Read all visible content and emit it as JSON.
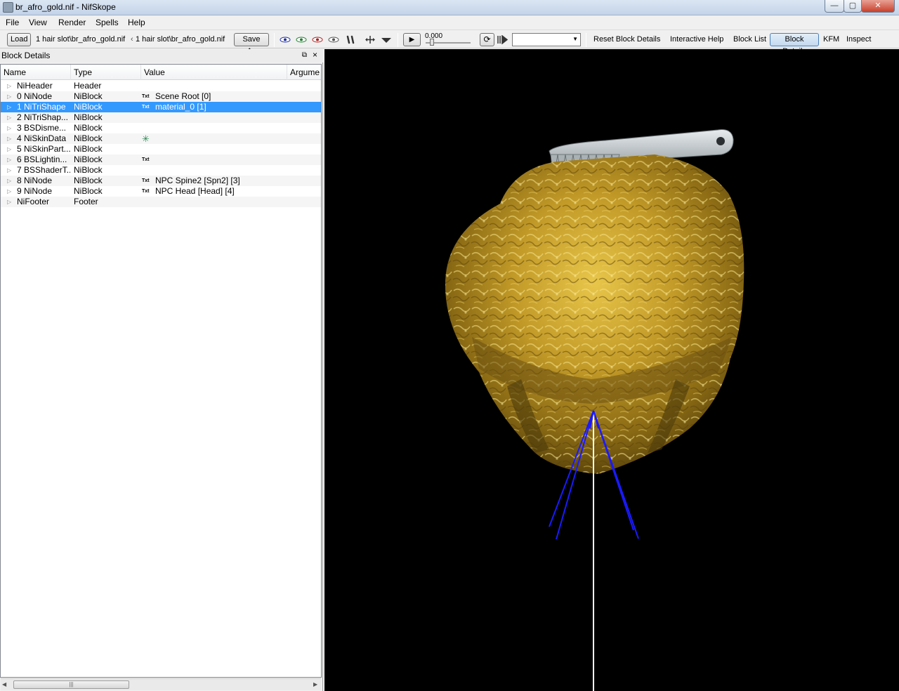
{
  "window": {
    "title": "br_afro_gold.nif - NifSkope",
    "minimize": "—",
    "maximize": "▢",
    "close": "✕"
  },
  "menu": [
    "File",
    "View",
    "Render",
    "Spells",
    "Help"
  ],
  "toolbar": {
    "load_label": "Load",
    "load_path": "1 hair slot\\br_afro_gold.nif",
    "save_path": "1 hair slot\\br_afro_gold.nif",
    "save_as_label": "Save As",
    "time_value": "0.000",
    "animation_select": "",
    "reset_block_details": "Reset Block Details",
    "interactive_help": "Interactive Help",
    "block_list": "Block List",
    "block_details": "Block Details",
    "kfm": "KFM",
    "inspect": "Inspect"
  },
  "panel": {
    "title": "Block Details",
    "columns": [
      "Name",
      "Type",
      "Value",
      "Argume"
    ],
    "rows": [
      {
        "name": "NiHeader",
        "type": "Header",
        "txt": "",
        "value": "",
        "star": false
      },
      {
        "name": "0 NiNode",
        "type": "NiBlock",
        "txt": "Txt",
        "value": "Scene Root [0]",
        "star": false
      },
      {
        "name": "1 NiTriShape",
        "type": "NiBlock",
        "txt": "Txt",
        "value": "material_0 [1]",
        "star": false,
        "selected": true
      },
      {
        "name": "2 NiTriShap...",
        "type": "NiBlock",
        "txt": "",
        "value": "",
        "star": false
      },
      {
        "name": "3 BSDisme...",
        "type": "NiBlock",
        "txt": "",
        "value": "",
        "star": false
      },
      {
        "name": "4 NiSkinData",
        "type": "NiBlock",
        "txt": "",
        "value": "",
        "star": true
      },
      {
        "name": "5 NiSkinPart...",
        "type": "NiBlock",
        "txt": "",
        "value": "",
        "star": false
      },
      {
        "name": "6 BSLightin...",
        "type": "NiBlock",
        "txt": "Txt",
        "value": "",
        "star": false
      },
      {
        "name": "7 BSShaderT...",
        "type": "NiBlock",
        "txt": "",
        "value": "",
        "star": false
      },
      {
        "name": "8 NiNode",
        "type": "NiBlock",
        "txt": "Txt",
        "value": "NPC Spine2 [Spn2] [3]",
        "star": false
      },
      {
        "name": "9 NiNode",
        "type": "NiBlock",
        "txt": "Txt",
        "value": "NPC Head [Head] [4]",
        "star": false
      },
      {
        "name": "NiFooter",
        "type": "Footer",
        "txt": "",
        "value": "",
        "star": false
      }
    ]
  },
  "colors": {
    "selection": "#3399ff",
    "viewport_bg": "#000000",
    "hair_gold": "#b8901f",
    "bone_blue": "#1010ff",
    "comb_silver": "#b5bcc0"
  }
}
